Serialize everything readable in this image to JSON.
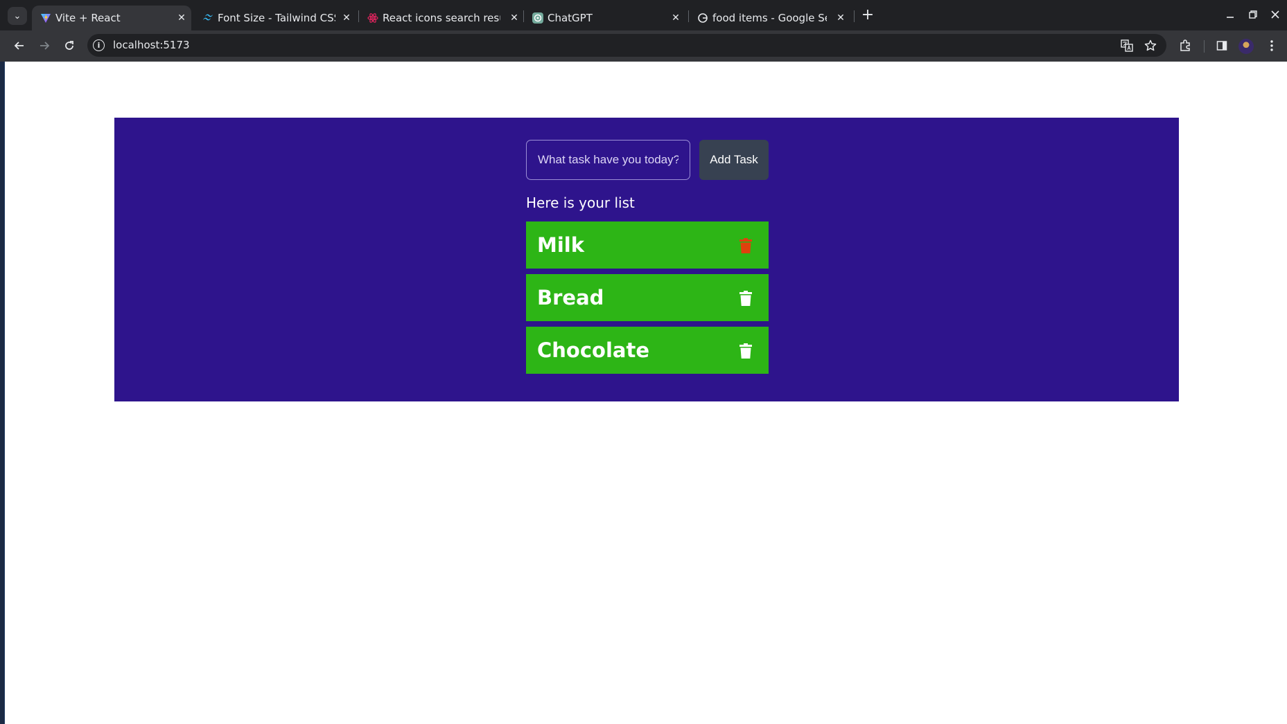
{
  "browser": {
    "tabs": [
      {
        "title": "Vite + React",
        "favicon": "vite-icon",
        "active": true
      },
      {
        "title": "Font Size - Tailwind CSS",
        "favicon": "tailwind-icon",
        "active": false
      },
      {
        "title": "React icons search result",
        "favicon": "react-icon",
        "active": false
      },
      {
        "title": "ChatGPT",
        "favicon": "chatgpt-icon",
        "active": false
      },
      {
        "title": "food items - Google Sear",
        "favicon": "google-icon",
        "active": false
      }
    ],
    "new_tab_label": "+",
    "address": "localhost:5173"
  },
  "app": {
    "colors": {
      "panel": "#2e148c",
      "item": "#2db516",
      "button": "#374151",
      "trash_hover": "#e0410d",
      "trash": "#ffffff"
    },
    "input": {
      "placeholder": "What task have you today?",
      "value": ""
    },
    "add_button_label": "Add Task",
    "list_heading": "Here is your list",
    "tasks": [
      {
        "label": "Milk",
        "trash_color": "#e0410d"
      },
      {
        "label": "Bread",
        "trash_color": "#ffffff"
      },
      {
        "label": "Chocolate",
        "trash_color": "#ffffff"
      }
    ]
  }
}
